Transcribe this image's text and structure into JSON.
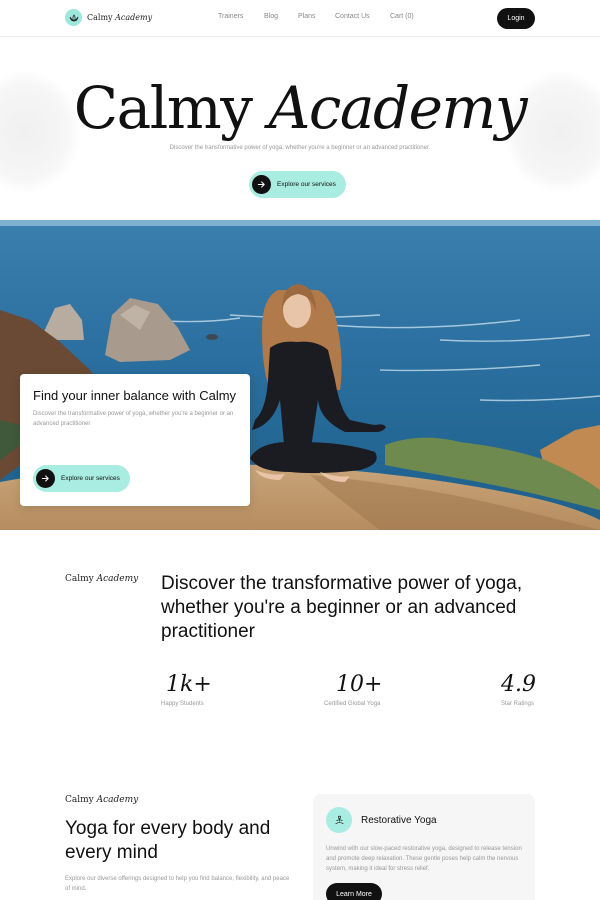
{
  "brand": {
    "name": "Calmy",
    "name_italic": "Academy"
  },
  "nav": {
    "links": [
      "Trainers",
      "Blog",
      "Plans",
      "Contact Us",
      "Cart (0)"
    ],
    "login_label": "Login"
  },
  "hero": {
    "title_regular": "Calmy",
    "title_italic": "Academy",
    "subtitle": "Discover the transformative power of yoga, whether you're a beginner or an advanced practitioner.",
    "cta_label": "Explore our services"
  },
  "feature_card": {
    "title": "Find your inner balance with Calmy",
    "text": "Discover the transformative power of yoga, whether you're a beginner or an advanced practitioner",
    "cta_label": "Explore our services"
  },
  "about": {
    "brand": "Calmy",
    "brand_italic": "Academy",
    "heading": "Discover the transformative power of yoga, whether you're a beginner or an advanced practitioner",
    "stats": [
      {
        "value": "1k+",
        "label": "Happy Students"
      },
      {
        "value": "10+",
        "label": "Certified Global Yoga"
      },
      {
        "value": "4.9",
        "label": "Star Ratings"
      }
    ]
  },
  "offerings": {
    "brand": "Calmy",
    "brand_italic": "Academy",
    "heading": "Yoga for every body and every mind",
    "text": "Explore our diverse offerings designed to help you find balance, flexibility, and peace of mind.",
    "service": {
      "title": "Restorative Yoga",
      "text": "Unwind with our slow-paced restorative yoga, designed to release tension and promote deep relaxation. These gentle poses help calm the nervous system, making it ideal for stress relief.",
      "button_label": "Learn More"
    }
  },
  "colors": {
    "accent": "#a8ece2",
    "dark": "#111111",
    "muted": "#999999"
  }
}
